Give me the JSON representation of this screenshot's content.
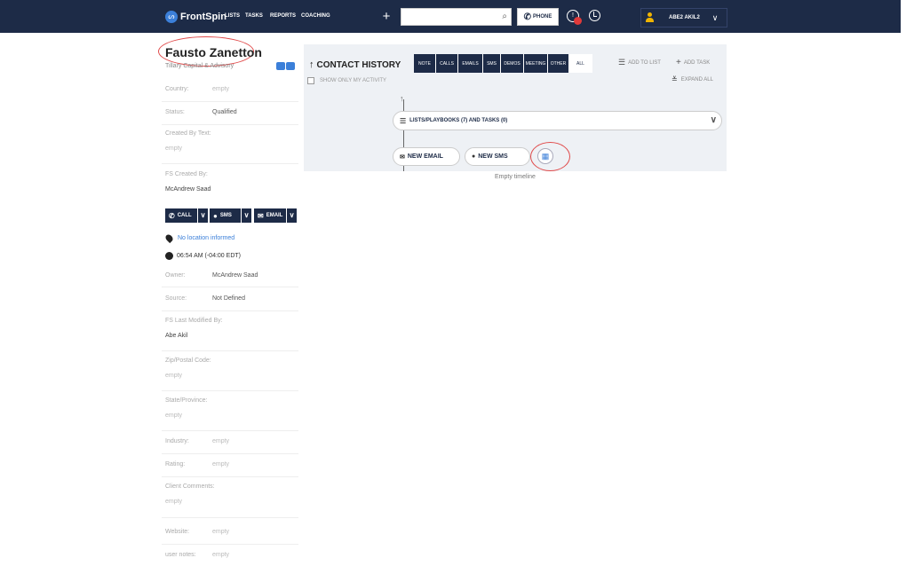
{
  "topbar": {
    "logo": "FrontSpin",
    "nav": [
      "LISTS",
      "TASKS",
      "REPORTS",
      "COACHING"
    ],
    "search_placeholder": "",
    "phone_label": "PHONE",
    "user_name": "ABE2 AKIL2"
  },
  "contact": {
    "name": "Fausto Zanetton",
    "company": "Tillary Capital & Advisory"
  },
  "fields": [
    {
      "label": "Country:",
      "value": "empty"
    },
    {
      "label": "Status:",
      "value": "Qualified"
    },
    {
      "label": "Created By Text:",
      "value": "empty"
    },
    {
      "label": "FS Created By:",
      "value": "McAndrew Saad"
    }
  ],
  "actions": {
    "call": "CALL",
    "sms": "SMS",
    "email": "EMAIL"
  },
  "location": "No location informed",
  "local_time": "06:54 AM (-04:00 EDT)",
  "fields2": [
    {
      "label": "Owner:",
      "value": "McAndrew Saad"
    },
    {
      "label": "Source:",
      "value": "Not Defined"
    },
    {
      "label": "FS Last Modified By:",
      "value": "Abe Akil"
    },
    {
      "label": "Zip/Postal Code:",
      "value": "empty"
    },
    {
      "label": "State/Province:",
      "value": "empty"
    },
    {
      "label": "Industry:",
      "value": "empty"
    },
    {
      "label": "Rating:",
      "value": "empty"
    },
    {
      "label": "Client Comments:",
      "value": "empty"
    },
    {
      "label": "Website:",
      "value": "empty"
    },
    {
      "label": "user notes:",
      "value": "empty"
    }
  ],
  "history": {
    "title": "CONTACT HISTORY",
    "filters": [
      "NOTE",
      "CALLS",
      "EMAILS",
      "SMS",
      "DEMOS",
      "MEETING",
      "OTHER",
      "ALL"
    ],
    "active_filter": "ALL",
    "only_mine": "SHOW ONLY MY ACTIVITY",
    "add_to_list": "ADD TO LIST",
    "add_task": "ADD TASK",
    "expand_all": "EXPAND ALL",
    "lists_bar": "LISTS/PLAYBOOKS (7) AND TASKS (0)",
    "new_email": "NEW EMAIL",
    "new_sms": "NEW SMS",
    "empty_text": "Empty timeline"
  },
  "colors": {
    "navy": "#1d2b47",
    "accent": "#3b7fd9",
    "annotation_red": "#e04b4b",
    "panel_bg": "#eef1f5"
  }
}
